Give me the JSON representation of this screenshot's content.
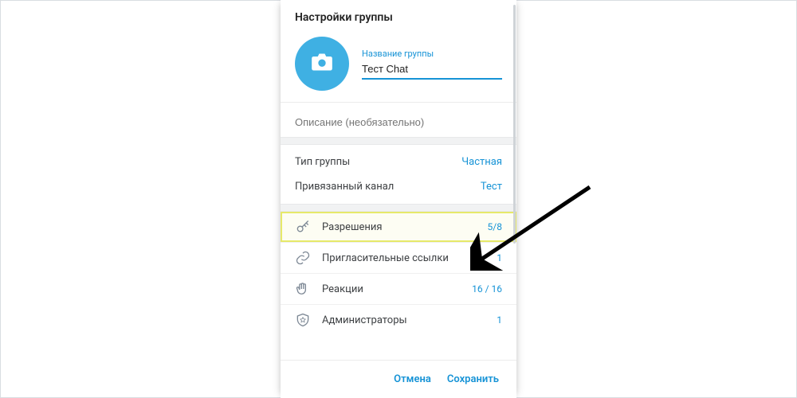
{
  "colors": {
    "accent": "#1693d6",
    "avatar": "#3fb0e3",
    "highlight": "#e6e96a"
  },
  "header": {
    "title": "Настройки группы"
  },
  "group": {
    "name_label": "Название группы",
    "name_value": "Тест Chat",
    "description_placeholder": "Описание (необязательно)"
  },
  "info": {
    "type_label": "Тип группы",
    "type_value": "Частная",
    "linked_channel_label": "Привязанный канал",
    "linked_channel_value": "Тест"
  },
  "menu": {
    "permissions": {
      "label": "Разрешения",
      "value": "5/8",
      "icon": "key-icon"
    },
    "invite_links": {
      "label": "Пригласительные ссылки",
      "value": "1",
      "icon": "link-icon"
    },
    "reactions": {
      "label": "Реакции",
      "value": "16 / 16",
      "icon": "wave-icon"
    },
    "admins": {
      "label": "Администраторы",
      "value": "1",
      "icon": "shield-icon"
    }
  },
  "footer": {
    "cancel": "Отмена",
    "save": "Сохранить"
  }
}
